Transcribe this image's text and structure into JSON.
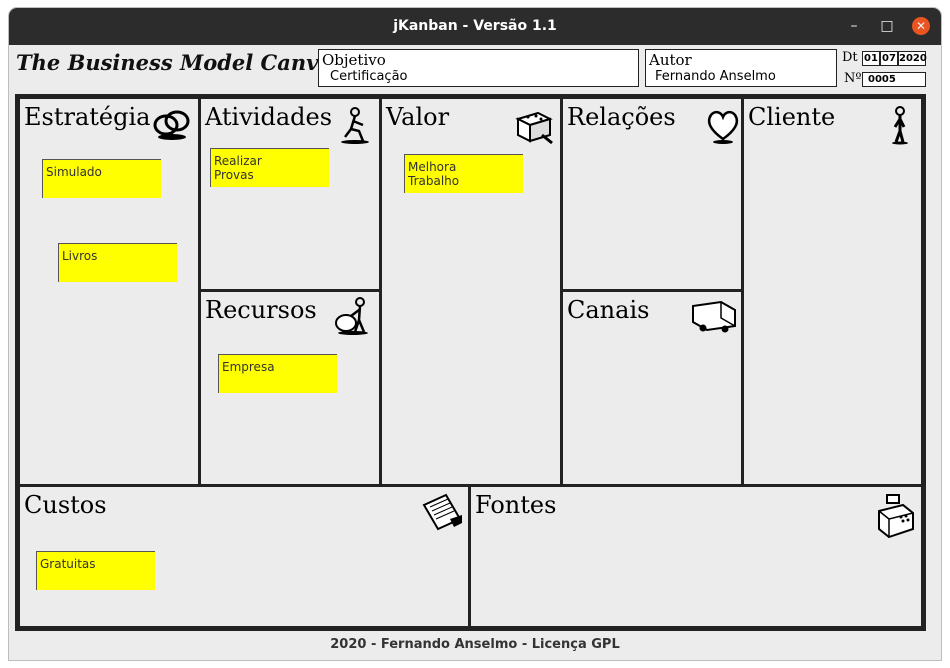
{
  "window": {
    "title": "jKanban - Versão 1.1"
  },
  "header": {
    "app_title": "The Business Model Canvas",
    "objective": {
      "label": "Objetivo",
      "value": "Certificação"
    },
    "author": {
      "label": "Autor",
      "value": "Fernando Anselmo"
    },
    "date": {
      "label": "Dt",
      "day": "01",
      "month": "07",
      "year": "2020"
    },
    "number": {
      "label": "Nº",
      "value": "0005"
    }
  },
  "canvas": {
    "estrategia": {
      "title": "Estratégia",
      "icon": "rings-icon",
      "notes": [
        "Simulado",
        "Livros"
      ]
    },
    "atividades": {
      "title": "Atividades",
      "icon": "worker-icon",
      "notes": [
        "Realizar\nProvas"
      ]
    },
    "recursos": {
      "title": "Recursos",
      "icon": "person-with-sack-icon",
      "notes": [
        "Empresa"
      ]
    },
    "valor": {
      "title": "Valor",
      "icon": "gift-box-icon",
      "notes": [
        "Melhora\nTrabalho"
      ]
    },
    "relacoes": {
      "title": "Relações",
      "icon": "heart-icon",
      "notes": []
    },
    "canais": {
      "title": "Canais",
      "icon": "truck-icon",
      "notes": []
    },
    "cliente": {
      "title": "Cliente",
      "icon": "person-icon",
      "notes": []
    },
    "custos": {
      "title": "Custos",
      "icon": "receipt-icon",
      "notes": [
        "Gratuitas"
      ]
    },
    "fontes": {
      "title": "Fontes",
      "icon": "cash-register-icon",
      "notes": []
    }
  },
  "colors": {
    "note": "#ffff00",
    "titlebar": "#2c2c2c",
    "close": "#e95420"
  },
  "footer": {
    "text": "2020 - Fernando Anselmo - Licença GPL"
  }
}
